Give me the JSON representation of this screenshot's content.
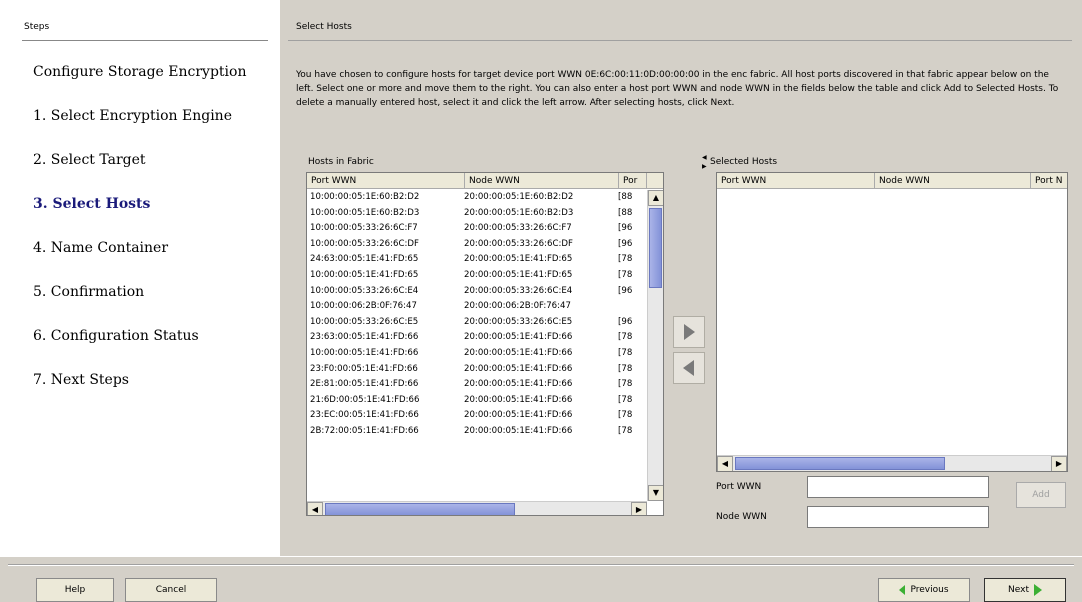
{
  "steps": {
    "header": "Steps",
    "items": [
      {
        "label": "Configure Storage Encryption"
      },
      {
        "label": "1. Select Encryption Engine"
      },
      {
        "label": "2. Select Target"
      },
      {
        "label": "3. Select Hosts"
      },
      {
        "label": "4. Name Container"
      },
      {
        "label": "5. Confirmation"
      },
      {
        "label": "6. Configuration Status"
      },
      {
        "label": "7. Next Steps"
      }
    ],
    "active_index": 3,
    "active_color": "#1a1a7a"
  },
  "main": {
    "title": "Select Hosts",
    "instructions": "You have chosen to configure hosts for target device port WWN 0E:6C:00:11:0D:00:00:00 in the enc fabric. All host ports discovered in that fabric appear below on the left. Select one or more and move them to the right. You can also enter a host port WWN and node WWN in the fields below the table and click Add to Selected Hosts. To delete a manually entered host, select it and click the left arrow. After selecting hosts, click Next."
  },
  "hosts_table": {
    "label": "Hosts in Fabric",
    "columns": [
      "Port WWN",
      "Node WWN",
      "Por"
    ],
    "rows": [
      [
        "10:00:00:05:1E:60:B2:D2",
        "20:00:00:05:1E:60:B2:D2",
        "[88"
      ],
      [
        "10:00:00:05:1E:60:B2:D3",
        "20:00:00:05:1E:60:B2:D3",
        "[88"
      ],
      [
        "10:00:00:05:33:26:6C:F7",
        "20:00:00:05:33:26:6C:F7",
        "[96"
      ],
      [
        "10:00:00:05:33:26:6C:DF",
        "20:00:00:05:33:26:6C:DF",
        "[96"
      ],
      [
        "24:63:00:05:1E:41:FD:65",
        "20:00:00:05:1E:41:FD:65",
        "[78"
      ],
      [
        "10:00:00:05:1E:41:FD:65",
        "20:00:00:05:1E:41:FD:65",
        "[78"
      ],
      [
        "10:00:00:05:33:26:6C:E4",
        "20:00:00:05:33:26:6C:E4",
        "[96"
      ],
      [
        "10:00:00:06:2B:0F:76:47",
        "20:00:00:06:2B:0F:76:47",
        ""
      ],
      [
        "10:00:00:05:33:26:6C:E5",
        "20:00:00:05:33:26:6C:E5",
        "[96"
      ],
      [
        "23:63:00:05:1E:41:FD:66",
        "20:00:00:05:1E:41:FD:66",
        "[78"
      ],
      [
        "10:00:00:05:1E:41:FD:66",
        "20:00:00:05:1E:41:FD:66",
        "[78"
      ],
      [
        "23:F0:00:05:1E:41:FD:66",
        "20:00:00:05:1E:41:FD:66",
        "[78"
      ],
      [
        "2E:81:00:05:1E:41:FD:66",
        "20:00:00:05:1E:41:FD:66",
        "[78"
      ],
      [
        "21:6D:00:05:1E:41:FD:66",
        "20:00:00:05:1E:41:FD:66",
        "[78"
      ],
      [
        "23:EC:00:05:1E:41:FD:66",
        "20:00:00:05:1E:41:FD:66",
        "[78"
      ],
      [
        "2B:72:00:05:1E:41:FD:66",
        "20:00:00:05:1E:41:FD:66",
        "[78"
      ]
    ]
  },
  "selected_table": {
    "label": "Selected Hosts",
    "columns": [
      "Port WWN",
      "Node WWN",
      "Port N"
    ]
  },
  "form": {
    "port_label": "Port WWN",
    "port_value": "",
    "node_label": "Node WWN",
    "node_value": "",
    "add_label": "Add"
  },
  "buttons": {
    "help": "Help",
    "cancel": "Cancel",
    "previous": "Previous",
    "next": "Next"
  },
  "icons": {
    "move_right": "triangle-right-icon",
    "move_left": "triangle-left-icon",
    "accent_gray": "#7a7a7a",
    "next_accent": "#3cb034",
    "previous_accent": "#3cb034"
  }
}
